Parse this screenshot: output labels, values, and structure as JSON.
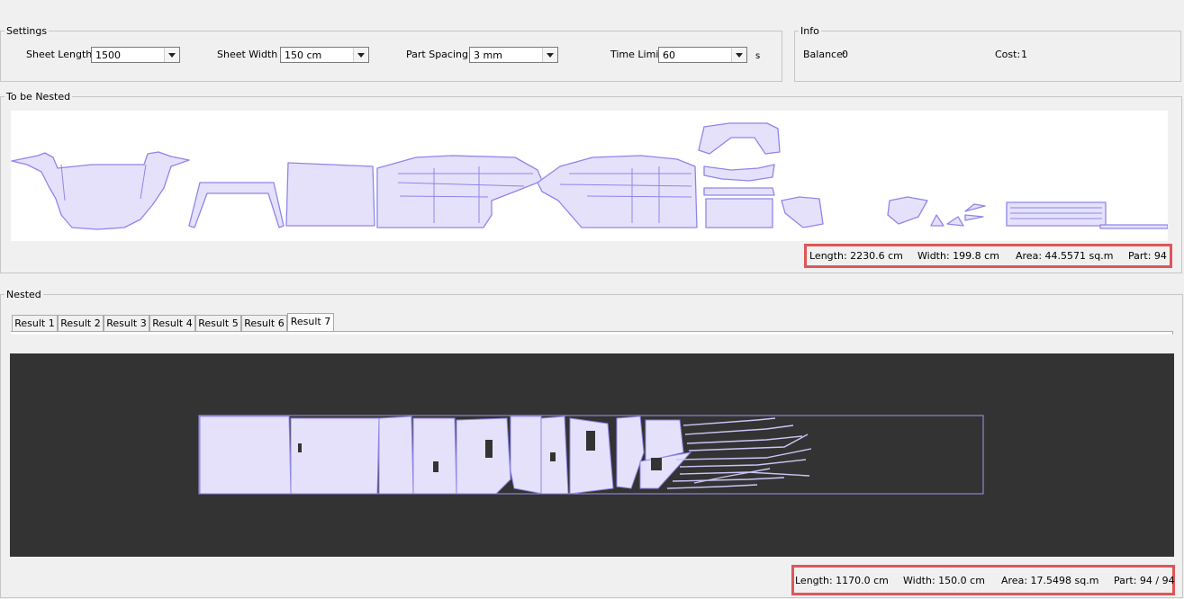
{
  "settings": {
    "legend": "Settings",
    "sheet_length_label": "Sheet Length",
    "sheet_length_value": "1500",
    "sheet_width_label": "Sheet Width",
    "sheet_width_value": "150 cm",
    "part_spacing_label": "Part Spacing",
    "part_spacing_value": "3 mm",
    "time_limit_label": "Time Limit",
    "time_limit_value": "60",
    "time_unit": "s"
  },
  "info": {
    "legend": "Info",
    "balance_label": "Balance:",
    "balance_value": "0",
    "cost_label": "Cost:",
    "cost_value": "1"
  },
  "to_be_nested": {
    "legend": "To be Nested",
    "length": "Length: 2230.6 cm",
    "width": "Width: 199.8 cm",
    "area": "Area: 44.5571 sq.m",
    "part": "Part: 94"
  },
  "nested": {
    "legend": "Nested",
    "tabs": [
      "Result 1",
      "Result 2",
      "Result 3",
      "Result 4",
      "Result 5",
      "Result 6",
      "Result 7"
    ],
    "active_tab": 6,
    "length": "Length: 1170.0 cm",
    "width": "Width: 150.0 cm",
    "area": "Area: 17.5498 sq.m",
    "part": "Part: 94 / 94"
  },
  "colors": {
    "part_fill": "#e6e1fb",
    "part_stroke": "#8d86ea",
    "canvas_dark": "#333333",
    "highlight": "#e05557"
  }
}
